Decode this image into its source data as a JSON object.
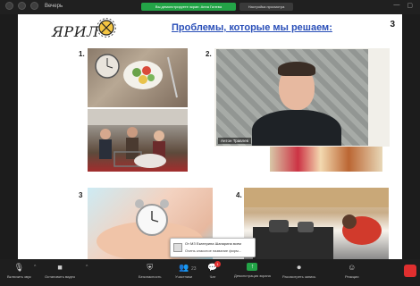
{
  "window": {
    "title": "Вечерь"
  },
  "share": {
    "banner": "Вы демонстрируете экран: Анна Гилева",
    "settings": "Настройка просмотра"
  },
  "slide": {
    "logo_text": "ЯРИЛ",
    "title": "Проблемы, которые мы решаем:",
    "page_number": "3",
    "items": [
      "1.",
      "2.",
      "3",
      "4."
    ]
  },
  "video": {
    "participant_name": "Антон Травлев"
  },
  "notification": {
    "line1": "От МЗ Екатерина Шапарина всем",
    "line2": "Очень классное название фирм..."
  },
  "toolbar": {
    "mute": "Включить звук",
    "video": "Остановить видео",
    "security": "Безопасность",
    "participants": "Участники",
    "participants_count": "23",
    "chat": "Чат",
    "chat_badge": "1",
    "share": "Демонстрация экрана",
    "record": "Рассмотреть запись",
    "reactions": "Реакции"
  },
  "colors": {
    "share_green": "#23a447",
    "title_blue": "#2a4fb8",
    "alert_red": "#e02f2f"
  }
}
